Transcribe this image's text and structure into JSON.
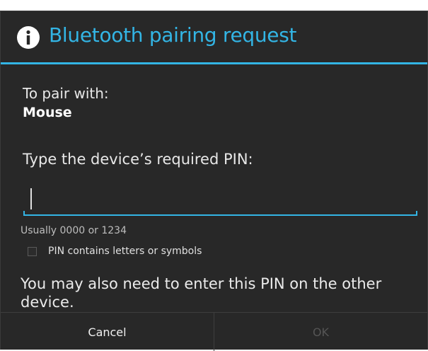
{
  "dialog": {
    "title": "Bluetooth pairing request",
    "title_icon": "info-icon",
    "accent_color": "#33b5e5",
    "background_color": "#282828"
  },
  "content": {
    "pair_with_label": "To pair with:",
    "device_name": "Mouse",
    "pin_prompt": "Type the device’s required PIN:",
    "pin_value": "",
    "pin_hint": "Usually 0000 or 1234",
    "checkbox_label": "PIN contains letters or symbols",
    "checkbox_checked": false,
    "also_enter_note": "You may also need to enter this PIN on the other device."
  },
  "buttons": {
    "cancel_label": "Cancel",
    "ok_label": "OK",
    "ok_enabled": false
  }
}
